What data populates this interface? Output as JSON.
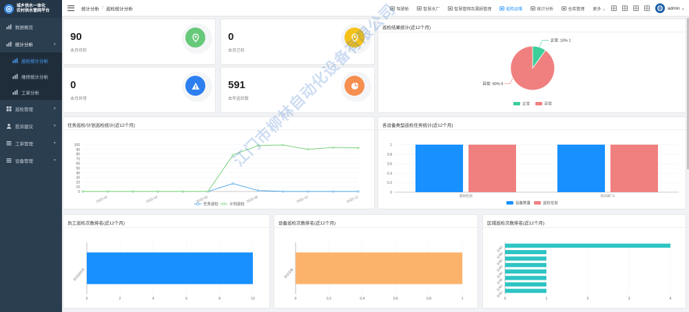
{
  "brand": {
    "line1": "城乡供水一体化",
    "line2": "农村供水管网平台"
  },
  "sidebar": {
    "items": [
      {
        "label": "数据概览",
        "icon": "chart-icon"
      },
      {
        "label": "统计分析",
        "icon": "chart-icon",
        "open": true
      },
      {
        "label": "巡检统计分析",
        "icon": "bar-icon",
        "sub": true,
        "active": true
      },
      {
        "label": "维修统计分析",
        "icon": "bar-icon",
        "sub": true
      },
      {
        "label": "工单分析",
        "icon": "bar-icon",
        "sub": true
      },
      {
        "label": "巡检管理",
        "icon": "grid-icon"
      },
      {
        "label": "投诉建议",
        "icon": "user-icon"
      },
      {
        "label": "工单管理",
        "icon": "list-icon"
      },
      {
        "label": "设备管理",
        "icon": "list-icon"
      }
    ]
  },
  "breadcrumb": {
    "level1": "统计分析",
    "separator": "/",
    "level2": "巡检统计分析"
  },
  "topnav": {
    "items": [
      {
        "label": "驾驶舱"
      },
      {
        "label": "智慧水厂"
      },
      {
        "label": "智慧管网及漏损管理"
      },
      {
        "label": "巡检运维",
        "active": true
      },
      {
        "label": "统计分析"
      },
      {
        "label": "仓库管理"
      },
      {
        "label": "更多"
      }
    ],
    "user": "admin"
  },
  "stats": [
    {
      "value": "90",
      "label": "本月待检",
      "color": "#67c97a",
      "icon": "location-icon"
    },
    {
      "value": "0",
      "label": "本月已检",
      "color": "#f5c21b",
      "icon": "location-icon"
    },
    {
      "value": "0",
      "label": "本月异常",
      "color": "#2d7ff0",
      "icon": "warning-icon"
    },
    {
      "value": "591",
      "label": "本年巡检数",
      "color": "#f58e4f",
      "icon": "pie-icon"
    }
  ],
  "watermark": "江门市柳林自动化设备有限公司",
  "charts": {
    "pie": {
      "title": "巡检结果统计(近12个月)",
      "chart_data": {
        "type": "pie",
        "slices": [
          {
            "name": "正常",
            "value": 1,
            "percent": "10%",
            "color": "#3ccf9a",
            "label": "正常: 10% 1"
          },
          {
            "name": "异常",
            "value": 9,
            "percent": "90%",
            "color": "#f08080",
            "label": "异常: 90% 9"
          }
        ],
        "legend": [
          "正常",
          "异常"
        ]
      }
    },
    "line": {
      "title": "任务巡检/计划巡检统计(近12个月)",
      "chart_data": {
        "type": "line",
        "x": [
          "2025-01",
          "2025-02",
          "2025-03",
          "2025-04",
          "2025-05",
          "2025-06",
          "2025-07",
          "2025-08",
          "2025-09",
          "2025-10",
          "2025-11",
          "2025-12"
        ],
        "xticks": [
          "2025-02",
          "2025-04",
          "2025-06",
          "2025-08",
          "2025-10",
          "2025-12"
        ],
        "ylim": [
          0,
          100
        ],
        "yticks": [
          "0",
          "10",
          "20",
          "30",
          "40",
          "50",
          "60",
          "70",
          "80",
          "90",
          "100"
        ],
        "series": [
          {
            "name": "任务巡检",
            "color": "#3ca0e6",
            "values": [
              0,
              0,
              0,
              0,
              0,
              0,
              17,
              2,
              0,
              0,
              0,
              0
            ]
          },
          {
            "name": "计划巡检",
            "color": "#66cc66",
            "values": [
              0,
              0,
              0,
              0,
              0,
              0,
              78,
              98,
              99,
              90,
              94,
              93
            ]
          }
        ],
        "extra_series_tail": 91
      }
    },
    "devicetype": {
      "title": "各设备类型巡检任务统计(近12个月)",
      "chart_data": {
        "type": "bar",
        "categories": [
          "漏损检测",
          "测试阀门1"
        ],
        "ylim": [
          0,
          1
        ],
        "yticks": [
          "0",
          "0.2",
          "0.4",
          "0.6",
          "0.8",
          "1"
        ],
        "series": [
          {
            "name": "设备数量",
            "color": "#1890ff",
            "values": [
              1,
              1
            ]
          },
          {
            "name": "巡检任务",
            "color": "#f08080",
            "values": [
              1,
              1
            ]
          }
        ]
      }
    },
    "staff": {
      "title": "员工巡检次数排名(近12个月)",
      "chart_data": {
        "type": "bar",
        "orientation": "horizontal",
        "categories": [
          "测试巡检员"
        ],
        "values": [
          10
        ],
        "xlim": [
          0,
          10
        ],
        "xticks": [
          "0",
          "2",
          "4",
          "6",
          "8",
          "10"
        ],
        "color": "#1890ff"
      }
    },
    "device": {
      "title": "设备巡检次数排名(近12个月)",
      "chart_data": {
        "type": "bar",
        "orientation": "horizontal",
        "categories": [
          "测试设备"
        ],
        "values": [
          1
        ],
        "xlim": [
          0,
          1
        ],
        "xticks": [
          "0",
          "0.2",
          "0.4",
          "0.6",
          "0.8",
          "1"
        ],
        "color": "#fbb36b"
      }
    },
    "region": {
      "title": "区域巡检次数排名(近12个月)",
      "chart_data": {
        "type": "bar",
        "orientation": "horizontal",
        "categories": [
          "区域A",
          "区域B",
          "区域C",
          "区域D",
          "区域E",
          "区域F",
          "区域G",
          "区域H"
        ],
        "values": [
          4,
          1,
          1,
          1,
          1,
          1,
          1,
          1
        ],
        "xlim": [
          0,
          4
        ],
        "xticks": [
          "0",
          "1",
          "2",
          "3",
          "4"
        ],
        "color": "#2ec4c4"
      }
    }
  }
}
